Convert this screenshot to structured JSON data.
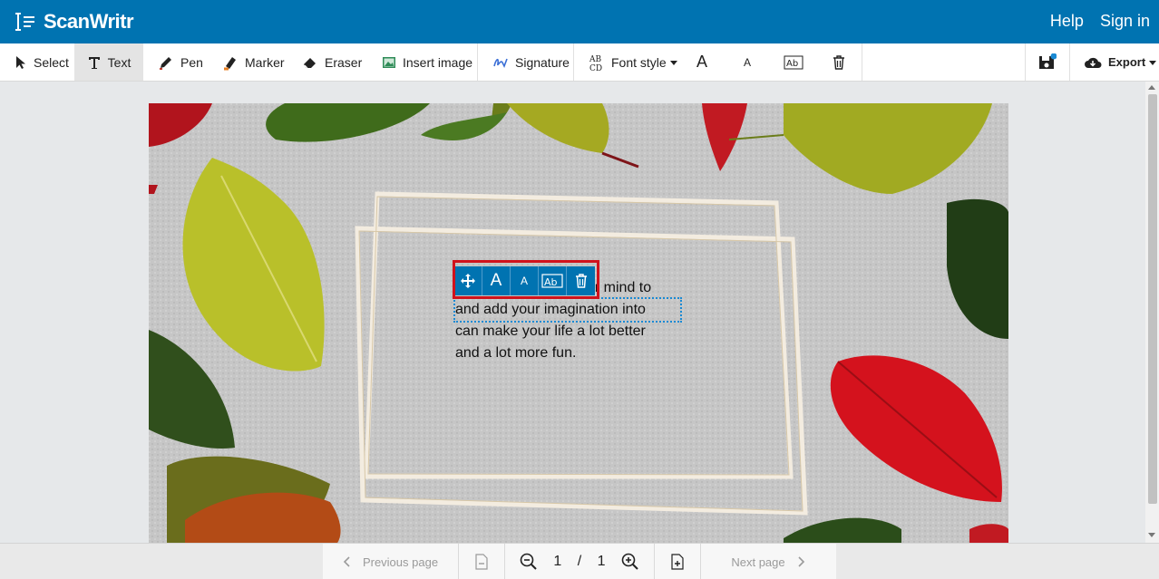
{
  "app": {
    "name": "ScanWritr",
    "header_links": [
      "Help",
      "Sign in"
    ]
  },
  "toolbar": {
    "select_label": "Select",
    "text_label": "Text",
    "pen_label": "Pen",
    "marker_label": "Marker",
    "eraser_label": "Eraser",
    "insert_image_label": "Insert image",
    "signature_label": "Signature",
    "font_style_label": "Font style",
    "export_label": "Export",
    "active_tool": "Text"
  },
  "document": {
    "text_lines": [
      "ur mind to",
      "and add your imagination into",
      "can make your life a lot better",
      "and a lot more fun."
    ]
  },
  "pagination": {
    "previous_label": "Previous page",
    "next_label": "Next page",
    "current_page": "1",
    "separator": "/",
    "total_pages": "1"
  },
  "colors": {
    "brand": "#0073b1",
    "highlight": "#d0121c",
    "selection": "#1a8ad4"
  }
}
